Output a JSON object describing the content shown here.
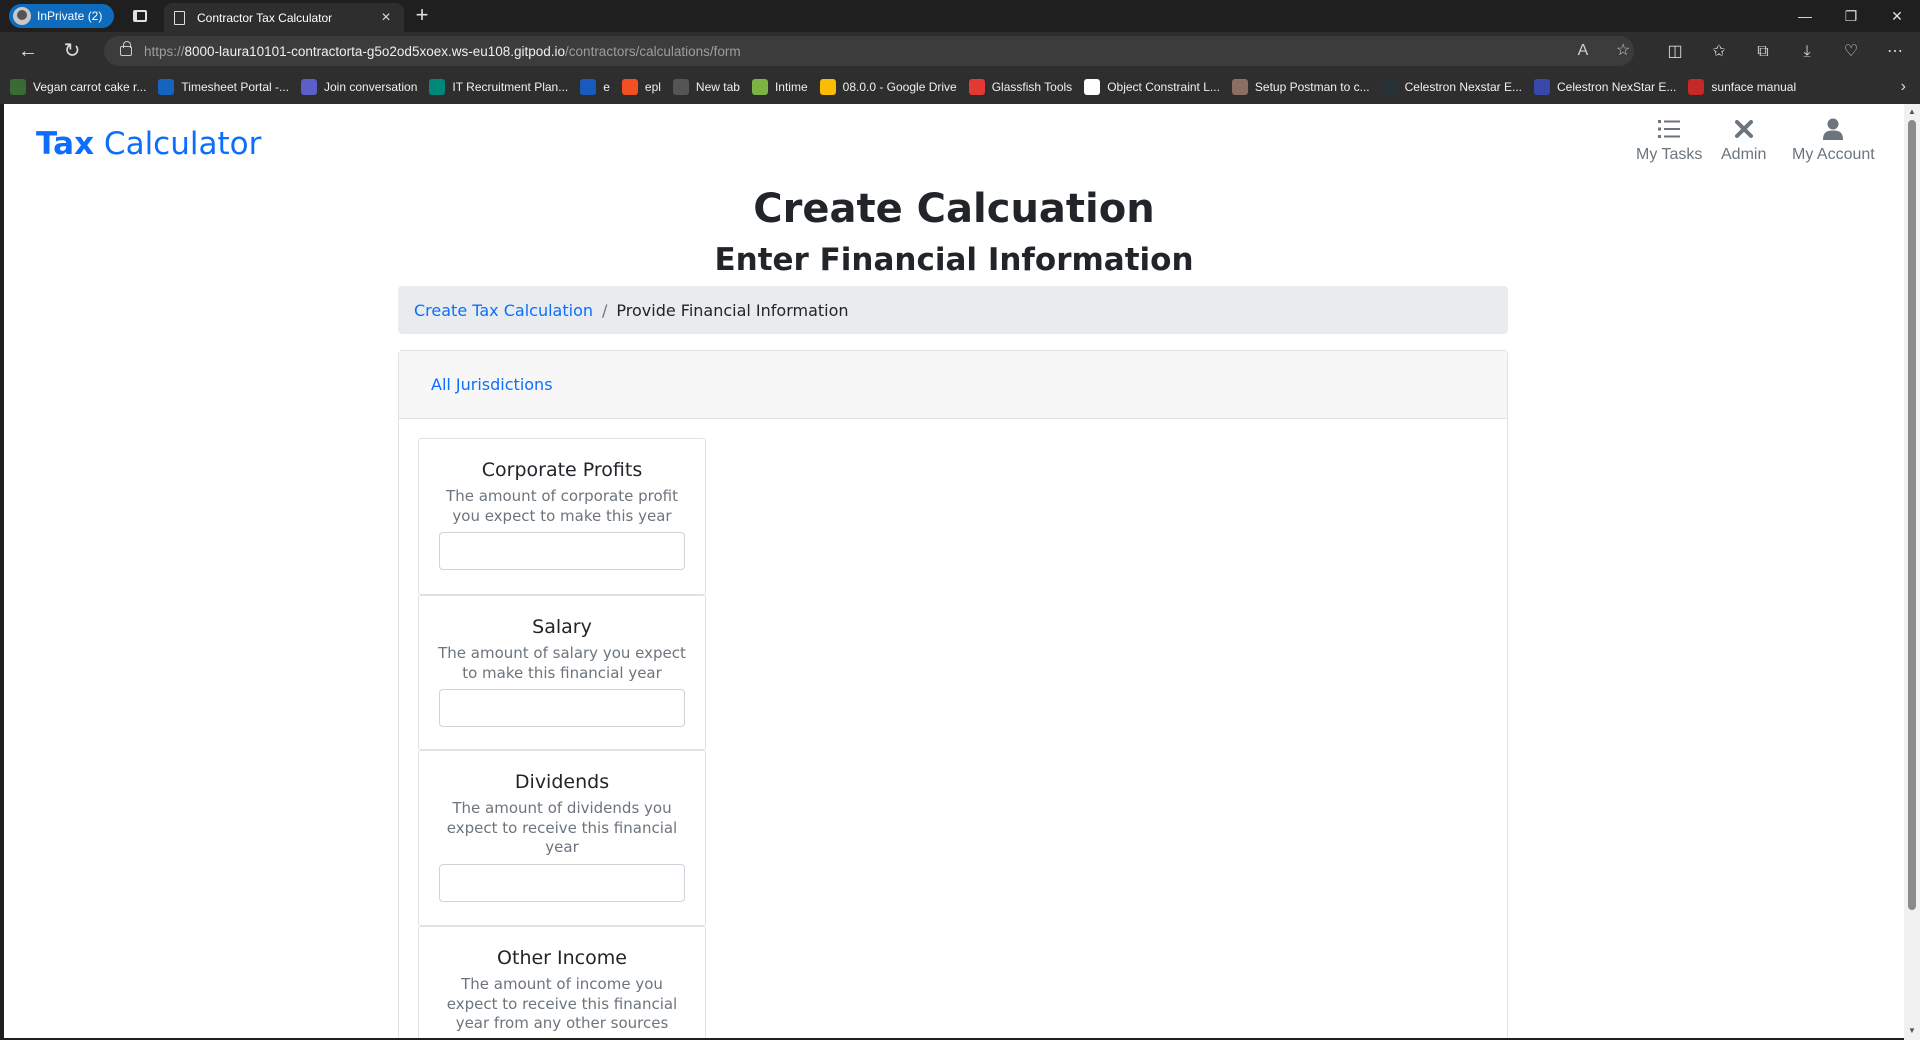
{
  "browser": {
    "profile_label": "InPrivate (2)",
    "tab_title": "Contractor Tax Calculator",
    "url_scheme": "https://",
    "url_host": "8000-laura10101-contractorta-g5o2od5xoex.ws-eu108.gitpod.io",
    "url_path": "/contractors/calculations/form",
    "bookmarks": [
      {
        "label": "Vegan carrot cake r...",
        "color": "#3a6b35"
      },
      {
        "label": "Timesheet Portal -...",
        "color": "#1565c0"
      },
      {
        "label": "Join conversation",
        "color": "#5b5fc7"
      },
      {
        "label": "IT Recruitment Plan...",
        "color": "#00897b"
      },
      {
        "label": "e",
        "color": "#185abd"
      },
      {
        "label": "epl",
        "color": "#f25022"
      },
      {
        "label": "New tab",
        "color": "#555555"
      },
      {
        "label": "Intime",
        "color": "#7cb342"
      },
      {
        "label": "08.0.0 - Google Drive",
        "color": "#fbbc04"
      },
      {
        "label": "Glassfish Tools",
        "color": "#e53935"
      },
      {
        "label": "Object Constraint L...",
        "color": "#ffffff"
      },
      {
        "label": "Setup Postman to c...",
        "color": "#8d6e63"
      },
      {
        "label": "Celestron Nexstar E...",
        "color": "#263238"
      },
      {
        "label": "Celestron NexStar E...",
        "color": "#3949ab"
      },
      {
        "label": "sunface manual",
        "color": "#c62828"
      }
    ]
  },
  "app": {
    "brand_bold": "Tax",
    "brand_rest": " Calculator",
    "nav": {
      "tasks": "My Tasks",
      "admin": "Admin",
      "account": "My Account"
    },
    "title": "Create Calcuation",
    "subtitle": "Enter Financial Information",
    "breadcrumb": {
      "link": "Create Tax Calculation",
      "separator": "/",
      "active": "Provide Financial Information"
    },
    "card_header_link": "All Jurisdictions",
    "fields": [
      {
        "title": "Corporate Profits",
        "description": "The amount of corporate profit you expect to make this year",
        "value": ""
      },
      {
        "title": "Salary",
        "description": "The amount of salary you expect to make this financial year",
        "value": ""
      },
      {
        "title": "Dividends",
        "description": "The amount of dividends you expect to receive this financial year",
        "value": ""
      },
      {
        "title": "Other Income",
        "description": "The amount of income you expect to receive this financial year from any other sources",
        "value": ""
      }
    ]
  },
  "colors": {
    "accent": "#0d6efd",
    "muted": "#6c757d",
    "breadcrumb_bg": "#e9ecef"
  }
}
